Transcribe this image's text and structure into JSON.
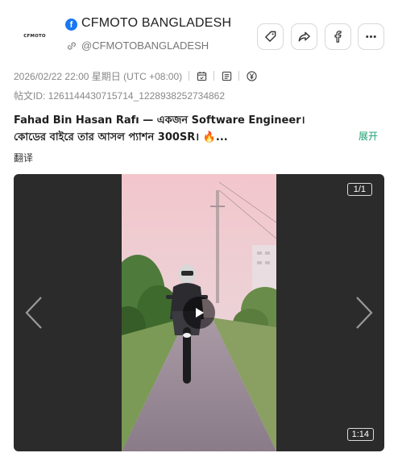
{
  "account": {
    "avatar_text": "CFMOTO",
    "name": "CFMOTO BANGLADESH",
    "handle": "@CFMOTOBANGLADESH",
    "platform_icon": "facebook-icon"
  },
  "actions": {
    "tag": "tag-icon",
    "share": "share-icon",
    "facebook": "facebook-icon",
    "more": "more-icon"
  },
  "meta": {
    "datetime": "2026/02/22 22:00 星期日 (UTC +08:00)",
    "post_id_label": "帖文ID:",
    "post_id": "1261144430715714_1228938252734862"
  },
  "post": {
    "line1": "Fahad Bin Hasan Rafı — একজন Software Engineer।",
    "line2": "কোডের বাইরে তার আসল প্যাশন 300SR। 🔥...",
    "expand_label": "展开",
    "translate_label": "翻译"
  },
  "media": {
    "counter": "1/1",
    "duration": "1:14"
  },
  "colors": {
    "accent_green": "#1aa16e",
    "facebook_blue": "#1877f2"
  }
}
